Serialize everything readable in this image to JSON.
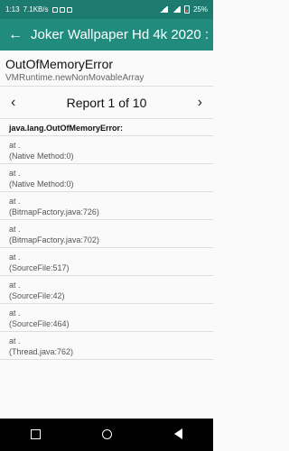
{
  "status": {
    "time": "1:13",
    "speed": "7.1KB/s",
    "battery": "25%"
  },
  "app_bar": {
    "title": "Joker Wallpaper Hd 4k 2020 :..."
  },
  "error": {
    "title": "OutOfMemoryError",
    "subtitle": "VMRuntime.newNonMovableArray"
  },
  "pager": {
    "label": "Report 1 of 10"
  },
  "trace": {
    "head": "java.lang.OutOfMemoryError:",
    "frames": [
      {
        "line1": "at .",
        "line2": "(Native Method:0)"
      },
      {
        "line1": "at .",
        "line2": "(Native Method:0)"
      },
      {
        "line1": "at .",
        "line2": "(BitmapFactory.java:726)"
      },
      {
        "line1": "at .",
        "line2": "(BitmapFactory.java:702)"
      },
      {
        "line1": "at .",
        "line2": "(SourceFile:517)"
      },
      {
        "line1": "at .",
        "line2": "(SourceFile:42)"
      },
      {
        "line1": "at .",
        "line2": "(SourceFile:464)"
      },
      {
        "line1": "at .",
        "line2": "(Thread.java:762)"
      }
    ]
  }
}
